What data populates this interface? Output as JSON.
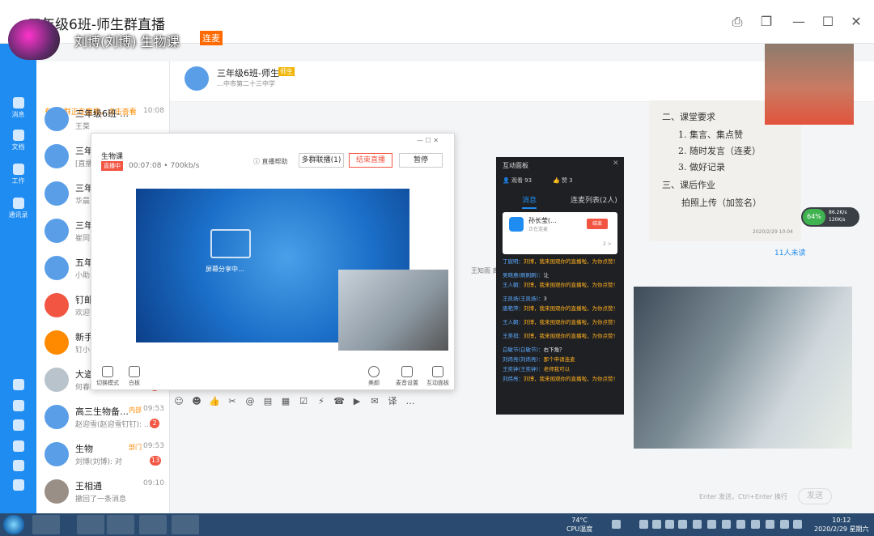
{
  "window": {
    "title": "三年级6班-师生群直播",
    "controls": [
      "screen-pin",
      "tile",
      "minimize",
      "maximize",
      "close"
    ]
  },
  "streamer": {
    "name": "刘博(刘博) 生物课",
    "tag": "连麦"
  },
  "sidebar": {
    "items": [
      {
        "label": "消息",
        "icon": "chat-icon"
      },
      {
        "label": "文档",
        "icon": "docs-icon"
      },
      {
        "label": "工作",
        "icon": "apps-icon"
      },
      {
        "label": "通讯录",
        "icon": "contacts-icon"
      }
    ]
  },
  "conversations": {
    "banner": "有2个群正在直播，点击查看",
    "items": [
      {
        "name": "三年级6班-…",
        "tag": "",
        "time": "10:08",
        "message": "王菜",
        "badge": ""
      },
      {
        "name": "三年",
        "tag": "",
        "time": "",
        "message": "[直播",
        "badge": ""
      },
      {
        "name": "三年",
        "tag": "",
        "time": "",
        "message": "华晨",
        "badge": ""
      },
      {
        "name": "三年",
        "tag": "",
        "time": "",
        "message": "崔同",
        "badge": ""
      },
      {
        "name": "五年",
        "tag": "",
        "time": "",
        "message": "小助",
        "badge": ""
      },
      {
        "name": "钉邮",
        "tag": "",
        "time": "",
        "message": "欢迎",
        "badge": ""
      },
      {
        "name": "新手",
        "tag": "",
        "time": "",
        "message": "钉小",
        "badge": ""
      },
      {
        "name": "大道",
        "tag": "",
        "time": "",
        "message": "何春翰(何春翰): 高二…",
        "badge": "5"
      },
      {
        "name": "高三生物备…",
        "tag": "内部",
        "time": "09:53",
        "message": "赵迎雪(赵迎雪钉钉): …",
        "badge": "2"
      },
      {
        "name": "生物",
        "tag": "部门",
        "time": "09:53",
        "message": "刘博(刘博): 对",
        "badge": "13"
      },
      {
        "name": "王相通",
        "tag": "",
        "time": "09:10",
        "message": "撤回了一条消息",
        "badge": ""
      }
    ]
  },
  "chat_header": {
    "title": "三年级6班-师生",
    "badge": "师生",
    "subtitle": "…中市第二十三中学"
  },
  "live_window": {
    "title": "生物课",
    "badge": "直播中",
    "duration": "00:07:08 • 700kb/s",
    "help": "直播帮助",
    "btn_multi": "多群联播(1)",
    "btn_end": "结束直播",
    "btn_pause": "暂停",
    "share_text": "屏幕分享中…",
    "tools": [
      "切换模式",
      "白板",
      "美颜",
      "麦音设置",
      "互动面板"
    ]
  },
  "panel": {
    "title": "互动面板",
    "viewers": "观看 93",
    "likes": "赞 3",
    "tab_messages": "消息",
    "tab_link": "连麦列表(2人)",
    "card_name": "孙长莹(...",
    "card_sub": "正在连麦",
    "card_btn": "结束",
    "card_count": "2 >",
    "messages": [
      {
        "user": "丁宸明：",
        "text": "刘博，我来围观你的直播啦，为你点赞！",
        "style": "o"
      },
      {
        "user": "吴晓惠(刷刷刷)：",
        "text": "让",
        "style": "w"
      },
      {
        "user": "王人朝：",
        "text": "刘博，我来围观你的直播啦，为你点赞！",
        "style": "o"
      },
      {
        "user": "王凯炀(王凯炀)：",
        "text": "3",
        "style": "w"
      },
      {
        "user": "唐艳萍：",
        "text": "刘博，我来围观你的直播啦，为你点赞！",
        "style": "o"
      },
      {
        "user": "王人朝：",
        "text": "刘博，我来围观你的直播啦，为你点赞！",
        "style": "o"
      },
      {
        "user": "王美祺：",
        "text": "刘博，我来围观你的直播啦，为你点赞！",
        "style": "o"
      },
      {
        "user": "白敏节(白敏节)：",
        "text": "右下角？",
        "style": "w"
      },
      {
        "user": "刘炜亮(刘炜亮)：",
        "text": "那个申请连麦",
        "style": "o"
      },
      {
        "user": "王奕钟(王奕钟)：",
        "text": "老师我可以",
        "style": "o"
      },
      {
        "user": "刘炜亮：",
        "text": "刘博，我来围观你的直播啦，为你点赞！",
        "style": "o"
      }
    ]
  },
  "whiteboard": {
    "lines": [
      "二、课堂要求",
      "1. 集言、集点赞",
      "2. 随时发言（连麦）",
      "3. 做好记录",
      "三、课后作业",
      "拍照上传（加签名）"
    ],
    "stamp": "2020/2/29 10:04"
  },
  "chat": {
    "read_count": "11人未读",
    "mid_label": "王知雨 离",
    "send_hint": "Enter 发送，Ctrl+Enter 换行",
    "send_button": "发送",
    "input_tools": [
      "emoji-icon",
      "smile-icon",
      "thumb-icon",
      "scissors-icon",
      "at-icon",
      "folder-icon",
      "calendar-icon",
      "check-icon",
      "ding-icon",
      "phone-icon",
      "video-icon",
      "mail-icon",
      "translate-icon",
      "more-icon"
    ]
  },
  "speed_widget": {
    "percent": "64%",
    "up": "86.2K/s",
    "down": "120K/s"
  },
  "taskbar": {
    "temperature": "74°C",
    "cpu_label": "CPU温度",
    "time": "10:12",
    "date": "2020/2/29 星期六"
  }
}
